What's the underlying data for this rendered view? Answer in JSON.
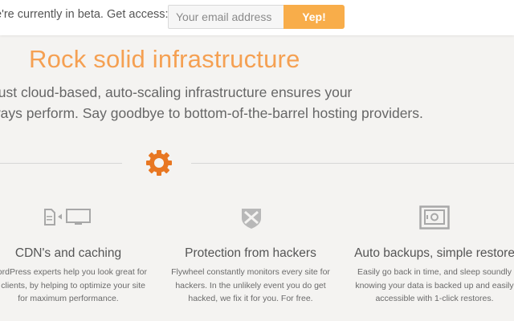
{
  "beta_bar": {
    "text": "e're currently in beta. Get access:",
    "email_placeholder": "Your email address",
    "submit_label": "Yep!"
  },
  "hero": {
    "title": "Rock solid infrastructure",
    "description_lines": [
      "bust cloud-based, auto-scaling infrastructure ensures your",
      "ways perform. Say goodbye to bottom-of-the-barrel hosting providers."
    ]
  },
  "divider": {
    "icon": "gear-icon"
  },
  "features": [
    {
      "icon": "cdn-monitor-icon",
      "title": "CDN's and caching",
      "description_lines": [
        "WordPress experts help you look great for",
        "ur clients, by helping to optimize your site",
        "for maximum performance."
      ]
    },
    {
      "icon": "shield-icon",
      "title": "Protection from hackers",
      "description_lines": [
        "Flywheel constantly monitors every site for",
        "hackers. In the unlikely event you do get",
        "hacked, we fix it for you. For free."
      ]
    },
    {
      "icon": "safe-icon",
      "title": "Auto backups, simple restore",
      "description_lines": [
        "Easily go back in time, and sleep soundly",
        "knowing your data is backed up and easily",
        "accessible with 1-click restores."
      ]
    }
  ],
  "colors": {
    "accent_orange": "#f5a052",
    "button_orange": "#f8ad4a",
    "gear_orange": "#e87722",
    "icon_gray": "#a8a8a8",
    "background": "#f4f3f1"
  }
}
